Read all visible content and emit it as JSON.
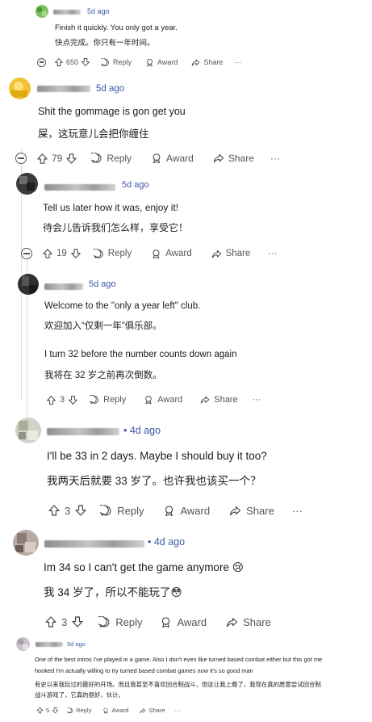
{
  "comments": [
    {
      "time": "5d ago",
      "line1": "Finish it quickly. You only got a year.",
      "line2": "快点完成。你只有一年时间。",
      "votes": "650",
      "reply": "Reply",
      "award": "Award",
      "share": "Share",
      "more": "···"
    },
    {
      "time": "5d ago",
      "line1": "Shit the gommage is gon get you",
      "line2": "屎，这玩意儿会把你缠住",
      "votes": "79",
      "reply": "Reply",
      "award": "Award",
      "share": "Share",
      "more": "···"
    },
    {
      "time": "5d ago",
      "line1": "Tell us later how it was, enjoy it!",
      "line2": "待会儿告诉我们怎么样，享受它！",
      "votes": "19",
      "reply": "Reply",
      "award": "Award",
      "share": "Share",
      "more": "···"
    },
    {
      "time": "5d ago",
      "line1": "Welcome to the \"only a year left\" club.",
      "line2": "欢迎加入“仅剩一年”俱乐部。",
      "line3": "I turn 32 before the number counts down again",
      "line4": "我将在 32 岁之前再次倒数。",
      "votes": "3",
      "reply": "Reply",
      "award": "Award",
      "share": "Share",
      "more": "···"
    },
    {
      "time": "• 4d ago",
      "line1": "I'll be 33 in 2 days. Maybe I should buy it too?",
      "line2": "我两天后就要 33 岁了。也许我也该买一个？",
      "votes": "3",
      "reply": "Reply",
      "award": "Award",
      "share": "Share",
      "more": "···"
    },
    {
      "time": "• 4d ago",
      "line1": "Im 34 so I can't get the game anymore 😢",
      "line2": "我 34 岁了，所以不能玩了😳",
      "votes": "3",
      "reply": "Reply",
      "award": "Award",
      "share": "Share"
    },
    {
      "time": "5d ago",
      "line1": "One of the best intros I've played in a game. Also I don't even like turned based combat either but this got me",
      "line2": "hooked I'm actually willing to try turned based combat games now it's so good man",
      "line3": "有史以来我玩过的最好的开场。而且我甚至不喜欢回合制战斗，但这让我上瘾了，我现在真的愿意尝试回合制",
      "line4": "战斗游戏了，它真的很好，伙计。",
      "votes": "5",
      "reply": "Reply",
      "award": "Award",
      "share": "Share",
      "more": "···"
    }
  ],
  "colors": {
    "link": "#3b5aa7",
    "text": "#1c1c1c",
    "meta": "#555555"
  }
}
